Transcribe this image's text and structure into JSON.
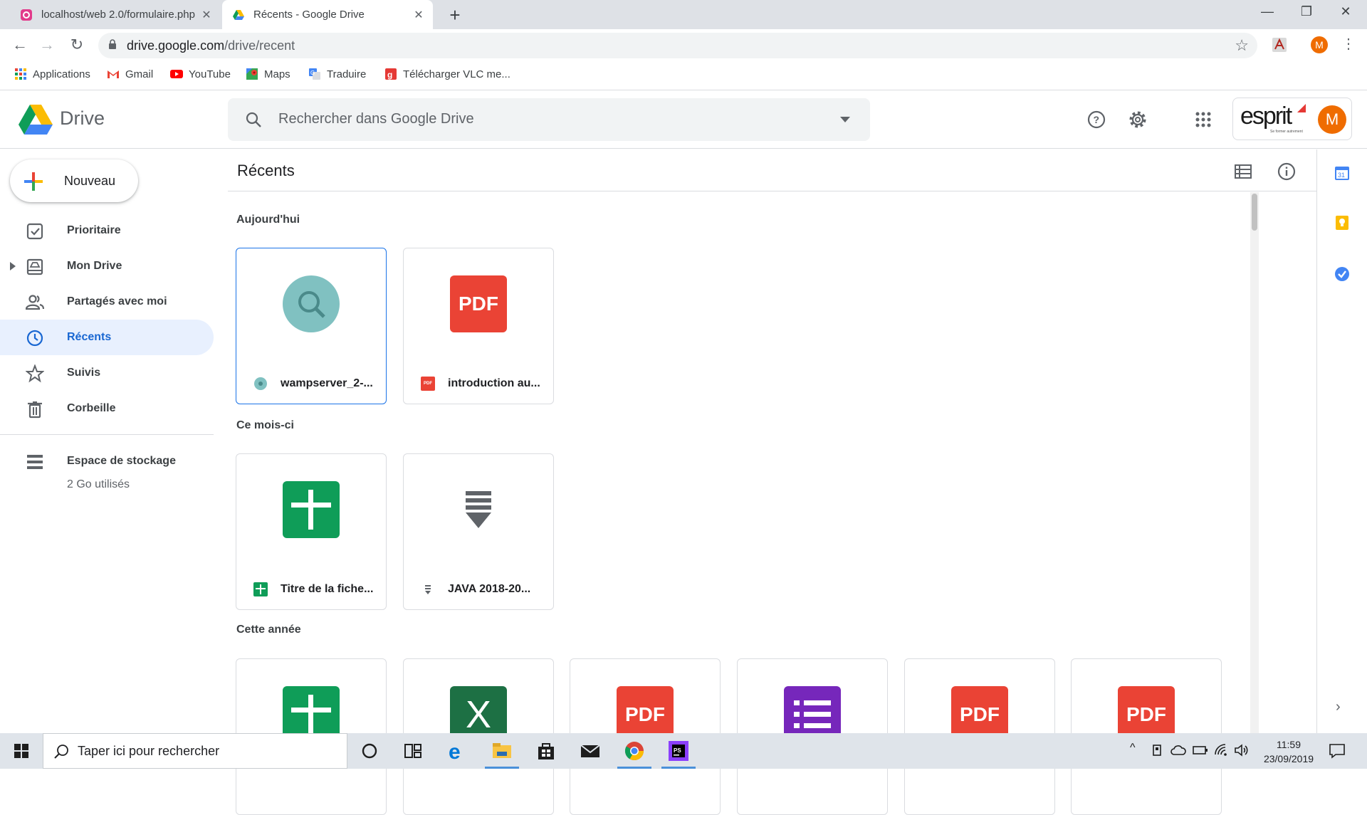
{
  "browser": {
    "tabs": [
      {
        "title": "localhost/web 2.0/formulaire.php",
        "active": false
      },
      {
        "title": "Récents - Google Drive",
        "active": true
      }
    ],
    "new_tab_label": "+",
    "window_controls": {
      "minimize": "—",
      "restore": "❐",
      "close": "✕"
    },
    "url_host": "drive.google.com",
    "url_path": "/drive/recent",
    "profile_initial": "M"
  },
  "bookmarks": [
    {
      "label": "Applications",
      "icon": "apps-grid-icon"
    },
    {
      "label": "Gmail",
      "icon": "gmail-icon"
    },
    {
      "label": "YouTube",
      "icon": "youtube-icon"
    },
    {
      "label": "Maps",
      "icon": "maps-icon"
    },
    {
      "label": "Traduire",
      "icon": "translate-icon"
    },
    {
      "label": "Télécharger VLC me...",
      "icon": "vlc-icon"
    }
  ],
  "drive": {
    "logo_text": "Drive",
    "search_placeholder": "Rechercher dans Google Drive",
    "org_logo_text": "esprit",
    "org_tagline": "Se former autrement",
    "account_initial": "M",
    "new_button": "Nouveau",
    "nav": [
      {
        "label": "Prioritaire",
        "icon": "priority-check-icon",
        "active": false
      },
      {
        "label": "Mon Drive",
        "icon": "my-drive-icon",
        "active": false
      },
      {
        "label": "Partagés avec moi",
        "icon": "shared-people-icon",
        "active": false
      },
      {
        "label": "Récents",
        "icon": "clock-icon",
        "active": true
      },
      {
        "label": "Suivis",
        "icon": "star-icon",
        "active": false
      },
      {
        "label": "Corbeille",
        "icon": "trash-icon",
        "active": false
      }
    ],
    "storage": {
      "label": "Espace de stockage",
      "used": "2 Go utilisés"
    },
    "page_title": "Récents",
    "sections": [
      {
        "title": "Aujourd'hui",
        "files": [
          {
            "name": "wampserver_2-...",
            "type": "search"
          },
          {
            "name": "introduction au...",
            "type": "pdf"
          }
        ]
      },
      {
        "title": "Ce mois-ci",
        "files": [
          {
            "name": "Titre de la fiche...",
            "type": "sheets"
          },
          {
            "name": "JAVA 2018-20...",
            "type": "archive"
          }
        ]
      },
      {
        "title": "Cette année",
        "files": [
          {
            "name": "",
            "type": "sheets"
          },
          {
            "name": "",
            "type": "excel"
          },
          {
            "name": "",
            "type": "pdf"
          },
          {
            "name": "",
            "type": "forms"
          },
          {
            "name": "",
            "type": "pdf"
          },
          {
            "name": "",
            "type": "pdf"
          }
        ]
      }
    ],
    "pdf_label": "PDF",
    "pdf_small": "PDF",
    "excel_label": "X",
    "calendar_day": "31"
  },
  "taskbar": {
    "search_placeholder": "Taper ici pour rechercher",
    "time": "11:59",
    "date": "23/09/2019"
  },
  "colors": {
    "accent": "#1a73e8",
    "active_nav_bg": "#e8f0fe",
    "pdf_red": "#ea4335",
    "sheets_green": "#0f9d58",
    "excel_green": "#1d7044",
    "forms_purple": "#7627bb",
    "avatar_orange": "#ef6c00"
  }
}
